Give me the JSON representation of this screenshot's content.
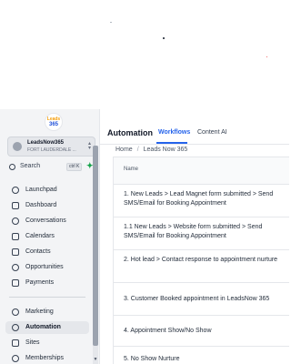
{
  "sidebar": {
    "logo_text_top": "Leads",
    "logo_text_bottom": "365",
    "account": {
      "name": "LeadsNow365",
      "location": "FORT LAUDERDALE ..."
    },
    "search": {
      "label": "Search",
      "shortcut": "ctrl K"
    },
    "nav_items": [
      {
        "label": "Launchpad",
        "icon": "rocket-icon"
      },
      {
        "label": "Dashboard",
        "icon": "dashboard-icon"
      },
      {
        "label": "Conversations",
        "icon": "chat-icon"
      },
      {
        "label": "Calendars",
        "icon": "calendar-icon"
      },
      {
        "label": "Contacts",
        "icon": "contacts-icon"
      },
      {
        "label": "Opportunities",
        "icon": "opportunities-icon"
      },
      {
        "label": "Payments",
        "icon": "payments-icon"
      }
    ],
    "nav_items_2": [
      {
        "label": "Marketing",
        "icon": "marketing-icon"
      },
      {
        "label": "Automation",
        "icon": "automation-icon",
        "active": true
      },
      {
        "label": "Sites",
        "icon": "sites-icon"
      },
      {
        "label": "Memberships",
        "icon": "memberships-icon"
      }
    ]
  },
  "header": {
    "title": "Automation",
    "tabs": [
      {
        "label": "Workflows",
        "active": true
      },
      {
        "label": "Content AI",
        "active": false
      }
    ]
  },
  "breadcrumb": {
    "home": "Home",
    "separator": "/",
    "current": "Leads Now 365"
  },
  "table": {
    "column_header": "Name",
    "rows": [
      "1. New Leads > Lead Magnet form submitted > Send SMS/Email for Booking Appointment",
      "1.1 New Leads > Website form submitted > Send SMS/Email for Booking Appointment",
      "2. Hot lead > Contact response to appointment nurture",
      "3. Customer Booked appointment in LeadsNow 365",
      "4. Appointment Show/No Show",
      "5. No Show Nurture"
    ]
  },
  "colors": {
    "accent": "#2563eb",
    "sidebar_bg": "#f3f4f6",
    "add_green": "#16a34a"
  }
}
